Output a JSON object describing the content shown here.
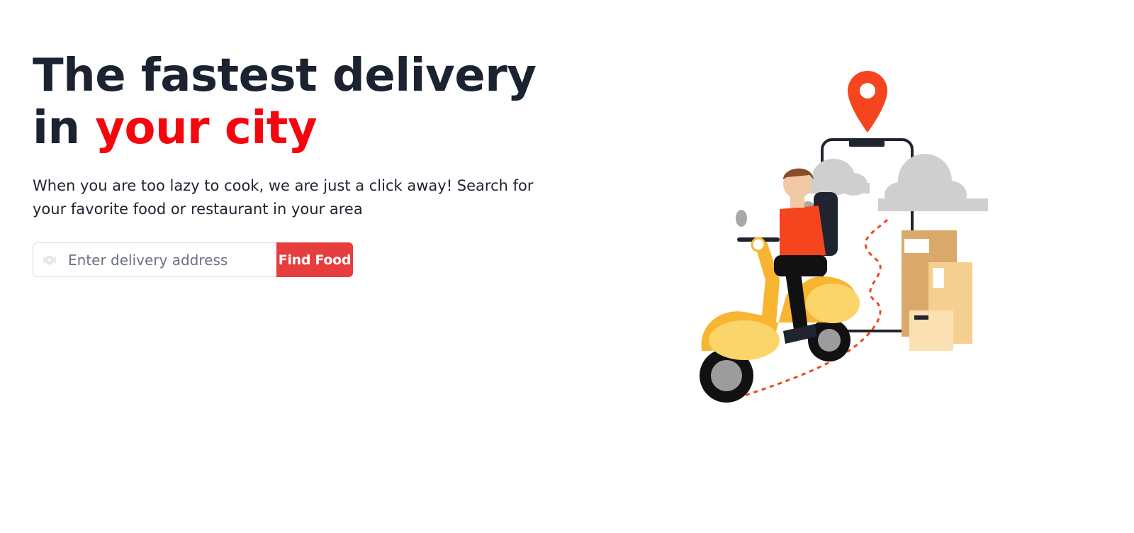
{
  "hero": {
    "headline_line1": "The fastest delivery",
    "headline_prefix": "in ",
    "headline_accent": "your city",
    "subtext": "When you are too lazy to cook, we are just a click away! Search for your favorite food or restaurant in your area"
  },
  "search": {
    "placeholder": "Enter delivery address",
    "icon": "plate-icon",
    "button_label": "Find Food"
  },
  "colors": {
    "accent": "#f5060f",
    "button": "#e63e3e",
    "headline": "#1b2230"
  },
  "illustration": {
    "subject": "delivery-scooter-illustration"
  }
}
